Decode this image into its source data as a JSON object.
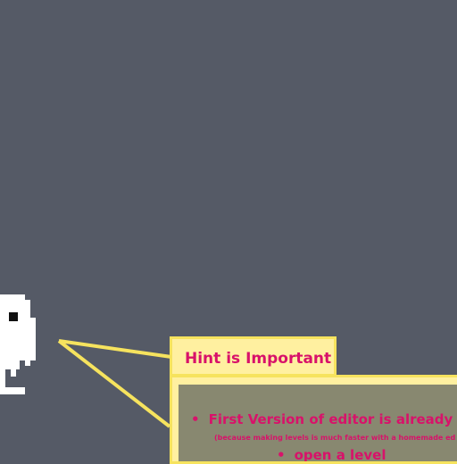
{
  "hint": {
    "title": "Hint is Important",
    "bullet": "•",
    "items": [
      "First Version of editor is already in th",
      "(because making levels is much faster with a homemade ed",
      "open a level"
    ]
  },
  "colors": {
    "background": "#555a66",
    "hint_text": "#d8126a",
    "hint_border": "#f6e35e",
    "hint_fill": "#fff0a0",
    "hint_body": "#888870",
    "character": "#ffffff"
  },
  "icons": {
    "character": "pixel-ghost-character-icon",
    "pointer": "speech-pointer-lines"
  }
}
